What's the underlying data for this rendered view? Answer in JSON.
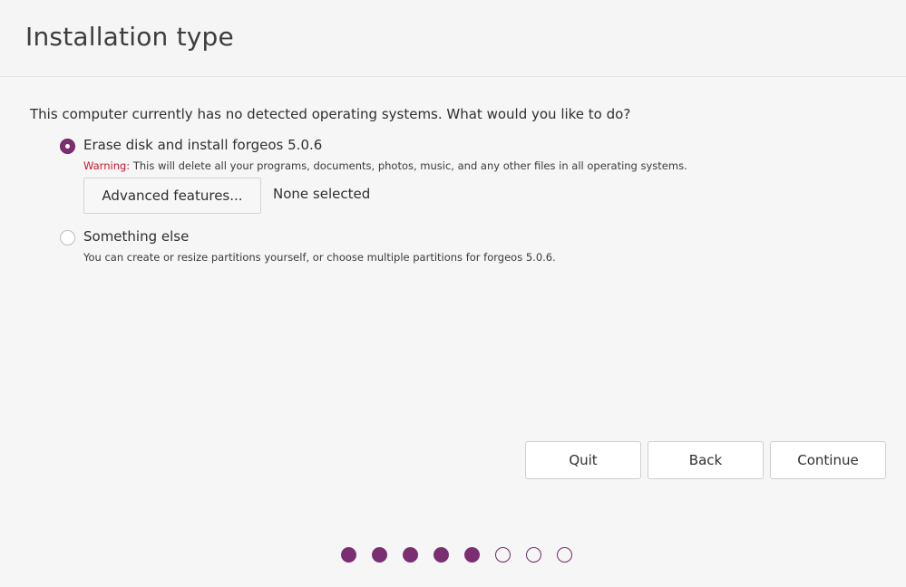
{
  "header": {
    "title": "Installation type"
  },
  "main": {
    "question": "This computer currently has no detected operating systems. What would you like to do?",
    "options": [
      {
        "label": "Erase disk and install forgeos 5.0.6",
        "selected": true,
        "warning_label": "Warning:",
        "description": "This will delete all your programs, documents, photos, music, and any other files in all operating systems."
      },
      {
        "label": "Something else",
        "selected": false,
        "description": "You can create or resize partitions yourself, or choose multiple partitions for forgeos 5.0.6."
      }
    ],
    "advanced": {
      "button_label": "Advanced features...",
      "status": "None selected"
    }
  },
  "footer": {
    "quit_label": "Quit",
    "back_label": "Back",
    "continue_label": "Continue"
  },
  "progress": {
    "total_steps": 8,
    "completed_steps": 5
  },
  "colors": {
    "accent": "#7b2f72",
    "warning": "#c7162b"
  }
}
